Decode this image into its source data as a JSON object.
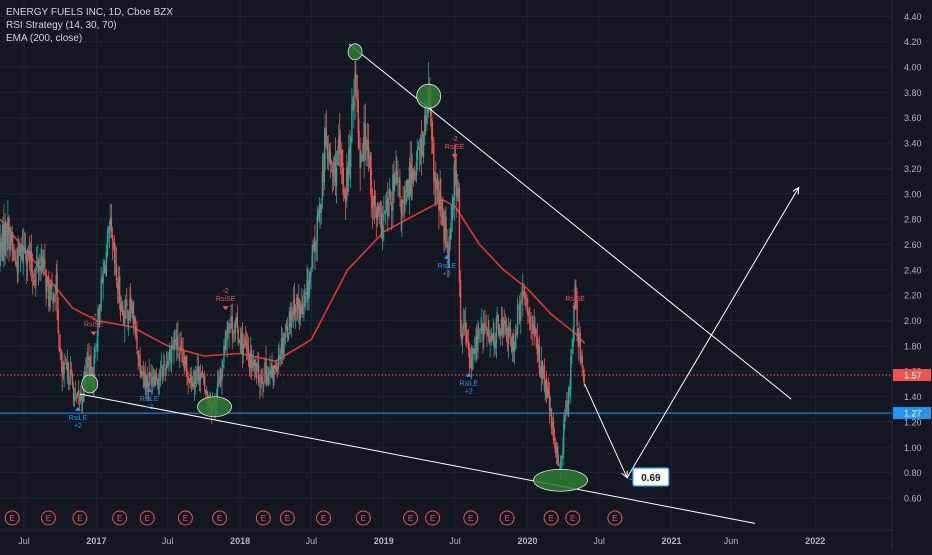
{
  "header": {
    "symbol_line": "ENERGY FUELS INC, 1D, Cboe BZX",
    "indicator_1": "RSI Strategy (14, 30, 70)",
    "indicator_2": "EMA (200, close)"
  },
  "colors": {
    "background": "#131722",
    "grid": "#1f2433",
    "up_candle": "#26a69a",
    "down_candle": "#ef5350",
    "ema": "#e0392b",
    "price_line": "#ef5350",
    "support_line": "#2196f3",
    "trendline": "#ffffff",
    "highlight_ellipse": "#2e7d32",
    "event_marker": "#ef5350",
    "axis_text": "#b2b5be"
  },
  "chart_data": {
    "type": "candlestick",
    "y_axis": {
      "min": 0.45,
      "max": 4.45,
      "tick_labels": [
        "4.40",
        "4.20",
        "4.00",
        "3.80",
        "3.60",
        "3.40",
        "3.20",
        "3.00",
        "2.80",
        "2.60",
        "2.40",
        "2.20",
        "2.00",
        "1.80",
        "1.60",
        "1.40",
        "1.20",
        "1.00",
        "0.80",
        "0.60"
      ],
      "side": "right"
    },
    "x_axis": {
      "start": "2016-05-01",
      "end": "2022-07-15",
      "tick_labels": [
        {
          "label": "Jul",
          "date": "2016-07-01"
        },
        {
          "label": "2017",
          "date": "2017-01-01"
        },
        {
          "label": "Jul",
          "date": "2017-07-01"
        },
        {
          "label": "2018",
          "date": "2018-01-01"
        },
        {
          "label": "Jul",
          "date": "2018-07-01"
        },
        {
          "label": "2019",
          "date": "2019-01-01"
        },
        {
          "label": "Jul",
          "date": "2019-07-01"
        },
        {
          "label": "2020",
          "date": "2020-01-01"
        },
        {
          "label": "Jul",
          "date": "2020-07-01"
        },
        {
          "label": "2021",
          "date": "2021-01-01"
        },
        {
          "label": "Jun",
          "date": "2021-06-01"
        },
        {
          "label": "2022",
          "date": "2022-01-01"
        }
      ]
    },
    "price_path": [
      [
        "2016-05-01",
        2.55
      ],
      [
        "2016-05-20",
        2.75
      ],
      [
        "2016-06-10",
        2.45
      ],
      [
        "2016-07-05",
        2.6
      ],
      [
        "2016-07-25",
        2.35
      ],
      [
        "2016-08-15",
        2.5
      ],
      [
        "2016-09-05",
        2.15
      ],
      [
        "2016-09-20",
        2.3
      ],
      [
        "2016-10-05",
        1.55
      ],
      [
        "2016-10-25",
        1.6
      ],
      [
        "2016-11-10",
        1.35
      ],
      [
        "2016-11-25",
        1.4
      ],
      [
        "2016-12-10",
        1.7
      ],
      [
        "2016-12-22",
        1.52
      ],
      [
        "2017-01-05",
        2.0
      ],
      [
        "2017-01-20",
        2.4
      ],
      [
        "2017-02-05",
        2.7
      ],
      [
        "2017-02-20",
        2.35
      ],
      [
        "2017-03-10",
        2.05
      ],
      [
        "2017-04-01",
        2.1
      ],
      [
        "2017-04-20",
        1.7
      ],
      [
        "2017-05-10",
        1.5
      ],
      [
        "2017-05-25",
        1.6
      ],
      [
        "2017-06-10",
        1.55
      ],
      [
        "2017-07-01",
        1.7
      ],
      [
        "2017-07-20",
        1.85
      ],
      [
        "2017-08-10",
        1.65
      ],
      [
        "2017-09-01",
        1.55
      ],
      [
        "2017-09-20",
        1.6
      ],
      [
        "2017-10-10",
        1.4
      ],
      [
        "2017-10-28",
        1.33
      ],
      [
        "2017-11-15",
        1.6
      ],
      [
        "2017-12-01",
        2.0
      ],
      [
        "2017-12-20",
        1.95
      ],
      [
        "2018-01-10",
        1.8
      ],
      [
        "2018-02-01",
        1.65
      ],
      [
        "2018-02-20",
        1.55
      ],
      [
        "2018-03-10",
        1.6
      ],
      [
        "2018-03-25",
        1.55
      ],
      [
        "2018-04-10",
        1.75
      ],
      [
        "2018-05-01",
        1.95
      ],
      [
        "2018-05-20",
        2.15
      ],
      [
        "2018-06-10",
        2.05
      ],
      [
        "2018-07-01",
        2.4
      ],
      [
        "2018-07-20",
        2.8
      ],
      [
        "2018-08-05",
        3.4
      ],
      [
        "2018-08-25",
        3.15
      ],
      [
        "2018-09-10",
        3.3
      ],
      [
        "2018-09-25",
        3.0
      ],
      [
        "2018-10-10",
        3.4
      ],
      [
        "2018-10-20",
        4.05
      ],
      [
        "2018-11-01",
        3.3
      ],
      [
        "2018-11-20",
        3.5
      ],
      [
        "2018-12-05",
        2.9
      ],
      [
        "2018-12-25",
        2.75
      ],
      [
        "2019-01-15",
        2.9
      ],
      [
        "2019-02-01",
        3.1
      ],
      [
        "2019-02-20",
        2.85
      ],
      [
        "2019-03-10",
        3.15
      ],
      [
        "2019-03-25",
        3.25
      ],
      [
        "2019-04-10",
        3.4
      ],
      [
        "2019-04-25",
        3.75
      ],
      [
        "2019-05-10",
        3.1
      ],
      [
        "2019-05-30",
        2.8
      ],
      [
        "2019-06-15",
        2.55
      ],
      [
        "2019-06-30",
        3.2
      ],
      [
        "2019-07-10",
        2.95
      ],
      [
        "2019-07-14",
        1.85
      ],
      [
        "2019-07-25",
        1.95
      ],
      [
        "2019-08-10",
        1.65
      ],
      [
        "2019-08-25",
        1.85
      ],
      [
        "2019-09-15",
        1.95
      ],
      [
        "2019-10-01",
        1.8
      ],
      [
        "2019-10-20",
        2.0
      ],
      [
        "2019-11-10",
        1.9
      ],
      [
        "2019-11-25",
        1.8
      ],
      [
        "2019-12-10",
        2.05
      ],
      [
        "2019-12-25",
        2.2
      ],
      [
        "2020-01-10",
        2.0
      ],
      [
        "2020-01-25",
        1.8
      ],
      [
        "2020-02-10",
        1.55
      ],
      [
        "2020-02-25",
        1.35
      ],
      [
        "2020-03-10",
        1.0
      ],
      [
        "2020-03-25",
        0.85
      ],
      [
        "2020-04-05",
        1.2
      ],
      [
        "2020-04-20",
        1.6
      ],
      [
        "2020-05-01",
        2.2
      ],
      [
        "2020-05-10",
        1.85
      ],
      [
        "2020-05-25",
        1.57
      ]
    ],
    "ema_200": [
      [
        "2016-05-01",
        2.8
      ],
      [
        "2016-08-01",
        2.45
      ],
      [
        "2016-11-01",
        2.1
      ],
      [
        "2017-01-01",
        2.0
      ],
      [
        "2017-04-01",
        1.95
      ],
      [
        "2017-07-01",
        1.8
      ],
      [
        "2017-10-01",
        1.72
      ],
      [
        "2018-01-01",
        1.74
      ],
      [
        "2018-04-01",
        1.68
      ],
      [
        "2018-07-01",
        1.85
      ],
      [
        "2018-10-01",
        2.4
      ],
      [
        "2019-01-01",
        2.7
      ],
      [
        "2019-04-01",
        2.85
      ],
      [
        "2019-06-01",
        2.95
      ],
      [
        "2019-07-01",
        2.9
      ],
      [
        "2019-09-01",
        2.6
      ],
      [
        "2019-11-01",
        2.4
      ],
      [
        "2020-01-01",
        2.25
      ],
      [
        "2020-03-01",
        2.05
      ],
      [
        "2020-05-01",
        1.9
      ],
      [
        "2020-05-25",
        1.82
      ]
    ],
    "current_price": {
      "value": 1.57,
      "label": "1.57"
    },
    "support_level": {
      "value": 1.27,
      "label": "1.27"
    },
    "target_callout": {
      "value": 0.69,
      "label": "0.69",
      "date": "2020-10-15"
    },
    "trendlines": [
      {
        "name": "upper-resistance",
        "from": [
          "2018-10-05",
          4.18
        ],
        "to": [
          "2021-11-01",
          1.38
        ]
      },
      {
        "name": "lower-support",
        "from": [
          "2016-11-20",
          1.42
        ],
        "to": [
          "2021-08-01",
          0.4
        ]
      },
      {
        "name": "projected-drop",
        "from": [
          "2020-05-25",
          1.5
        ],
        "to": [
          "2020-09-10",
          0.76
        ]
      },
      {
        "name": "projected-rise",
        "from": [
          "2020-09-10",
          0.76
        ],
        "to": [
          "2021-11-20",
          3.05
        ]
      }
    ],
    "highlights": [
      {
        "date": "2018-10-20",
        "price": 4.12,
        "rx": 7,
        "ry": 8
      },
      {
        "date": "2019-04-25",
        "price": 3.77,
        "rx": 12,
        "ry": 12
      },
      {
        "date": "2016-12-15",
        "price": 1.5,
        "rx": 8,
        "ry": 9
      },
      {
        "date": "2017-10-28",
        "price": 1.32,
        "rx": 17,
        "ry": 10
      },
      {
        "date": "2020-03-25",
        "price": 0.74,
        "rx": 27,
        "ry": 11
      }
    ],
    "signals": [
      {
        "label": "RsiLE",
        "sub": "+2",
        "type": "long",
        "date": "2016-11-15",
        "price": 1.35
      },
      {
        "label": "RsiSE",
        "sub": "-2",
        "type": "short",
        "date": "2016-12-25",
        "price": 1.85
      },
      {
        "label": "RsiLE",
        "sub": "+2",
        "type": "long",
        "date": "2017-05-15",
        "price": 1.5
      },
      {
        "label": "RsiSE",
        "sub": "-2",
        "type": "short",
        "date": "2017-11-25",
        "price": 2.05
      },
      {
        "label": "RsiLE",
        "sub": "+2",
        "type": "long",
        "date": "2019-06-10",
        "price": 2.55
      },
      {
        "label": "RsiSE",
        "sub": "-2",
        "type": "short",
        "date": "2019-06-30",
        "price": 3.25
      },
      {
        "label": "RsiLE",
        "sub": "+2",
        "type": "long",
        "date": "2019-08-05",
        "price": 1.62
      },
      {
        "label": "RsiSE",
        "sub": "-2",
        "type": "short",
        "date": "2020-05-01",
        "price": 2.05
      }
    ],
    "event_markers": {
      "label": "E",
      "dates": [
        "2016-06-01",
        "2016-09-01",
        "2016-11-20",
        "2017-03-01",
        "2017-05-10",
        "2017-08-15",
        "2017-11-10",
        "2018-03-01",
        "2018-05-01",
        "2018-08-01",
        "2018-11-10",
        "2019-03-10",
        "2019-05-05",
        "2019-08-10",
        "2019-11-10",
        "2020-03-01",
        "2020-04-25",
        "2020-08-10"
      ]
    }
  }
}
